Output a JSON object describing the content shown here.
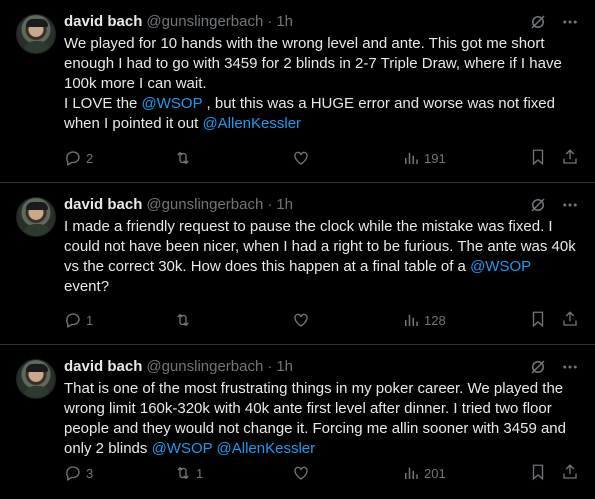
{
  "tweets": [
    {
      "author": "david bach",
      "handle": "@gunslingerbach",
      "separator": "·",
      "time": "1h",
      "text_parts": [
        {
          "text": "We played for 10 hands with the wrong level and ante. This got me short enough I had to go with 3459 for 2 blinds in 2-7 Triple Draw, where if I have 100k more I can wait.\nI LOVE the ",
          "mention": false
        },
        {
          "text": "@WSOP",
          "mention": true
        },
        {
          "text": " , but this was a HUGE error and worse was not fixed when I pointed it out ",
          "mention": false
        },
        {
          "text": "@AllenKessler",
          "mention": true
        }
      ],
      "replies": "2",
      "reposts": "",
      "likes": "",
      "views": "191"
    },
    {
      "author": "david bach",
      "handle": "@gunslingerbach",
      "separator": "·",
      "time": "1h",
      "text_parts": [
        {
          "text": "I made a friendly request to pause the clock while the mistake was fixed. I could not have been nicer, when I had a right to be furious. The ante was 40k vs the correct 30k. How does this happen at a final table of a ",
          "mention": false
        },
        {
          "text": "@WSOP",
          "mention": true
        },
        {
          "text": " event?",
          "mention": false
        }
      ],
      "replies": "1",
      "reposts": "",
      "likes": "",
      "views": "128"
    },
    {
      "author": "david bach",
      "handle": "@gunslingerbach",
      "separator": "·",
      "time": "1h",
      "text_parts": [
        {
          "text": "That is one of the most frustrating things in my poker career. We played the wrong limit 160k-320k with 40k ante first level after dinner. I tried two floor people and they would not change it. Forcing me allin sooner with 3459 and only 2 blinds ",
          "mention": false
        },
        {
          "text": "@WSOP",
          "mention": true
        },
        {
          "text": " ",
          "mention": false
        },
        {
          "text": "@AllenKessler",
          "mention": true
        }
      ],
      "replies": "3",
      "reposts": "1",
      "likes": "",
      "views": "201"
    }
  ],
  "colors": {
    "background": "#000000",
    "text": "#e7e9ea",
    "muted": "#71767b",
    "link": "#1d9bf0",
    "divider": "#2f3336"
  },
  "icons": [
    "grok-icon",
    "more-icon",
    "reply-icon",
    "repost-icon",
    "like-icon",
    "views-icon",
    "bookmark-icon",
    "share-icon"
  ]
}
